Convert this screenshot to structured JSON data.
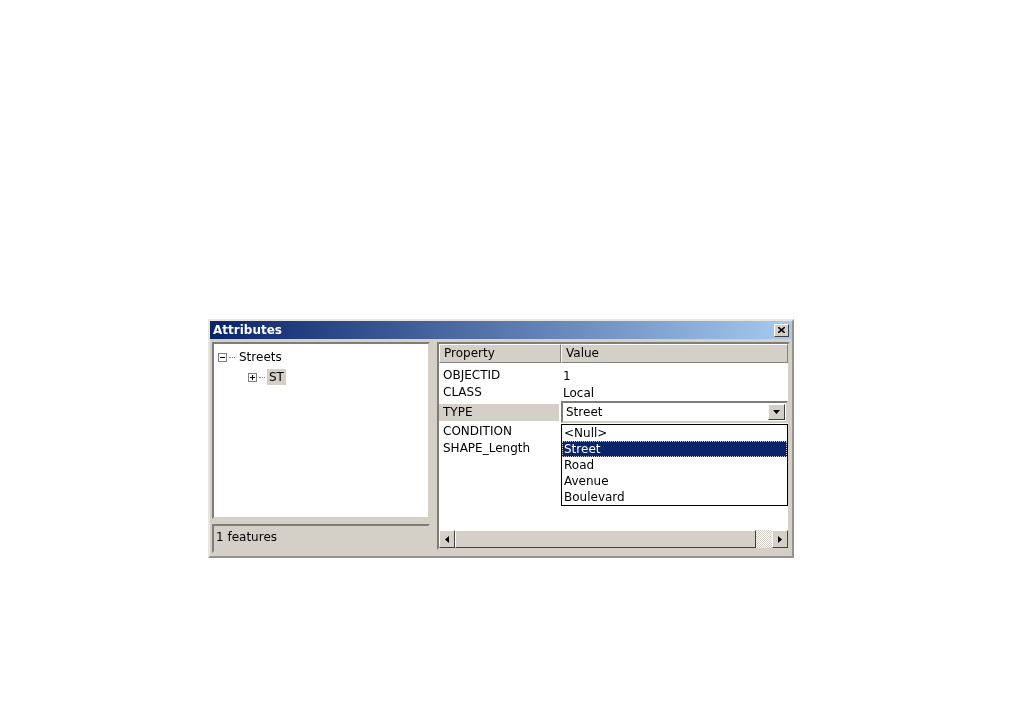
{
  "window": {
    "title": "Attributes"
  },
  "tree": [
    {
      "label": "Streets",
      "expanded": true,
      "selected": false,
      "children": [
        {
          "label": "ST",
          "expanded": false,
          "selected": true
        }
      ]
    }
  ],
  "status_bar": "1 features",
  "table": {
    "columns": [
      "Property",
      "Value"
    ],
    "rows": [
      {
        "property": "OBJECTID",
        "value": "1",
        "kind": "text",
        "selected": false
      },
      {
        "property": "CLASS",
        "value": "Local",
        "kind": "text",
        "selected": false
      },
      {
        "property": "TYPE",
        "value": "Street",
        "kind": "dropdown",
        "selected": true,
        "expanded": true,
        "options": [
          {
            "label": "<Null>",
            "selected": false
          },
          {
            "label": "Street",
            "selected": true
          },
          {
            "label": "Road",
            "selected": false
          },
          {
            "label": "Avenue",
            "selected": false
          },
          {
            "label": "Boulevard",
            "selected": false
          }
        ]
      },
      {
        "property": "CONDITION",
        "kind": "text",
        "selected": false
      },
      {
        "property": "SHAPE_Length",
        "kind": "text",
        "selected": false
      }
    ]
  }
}
